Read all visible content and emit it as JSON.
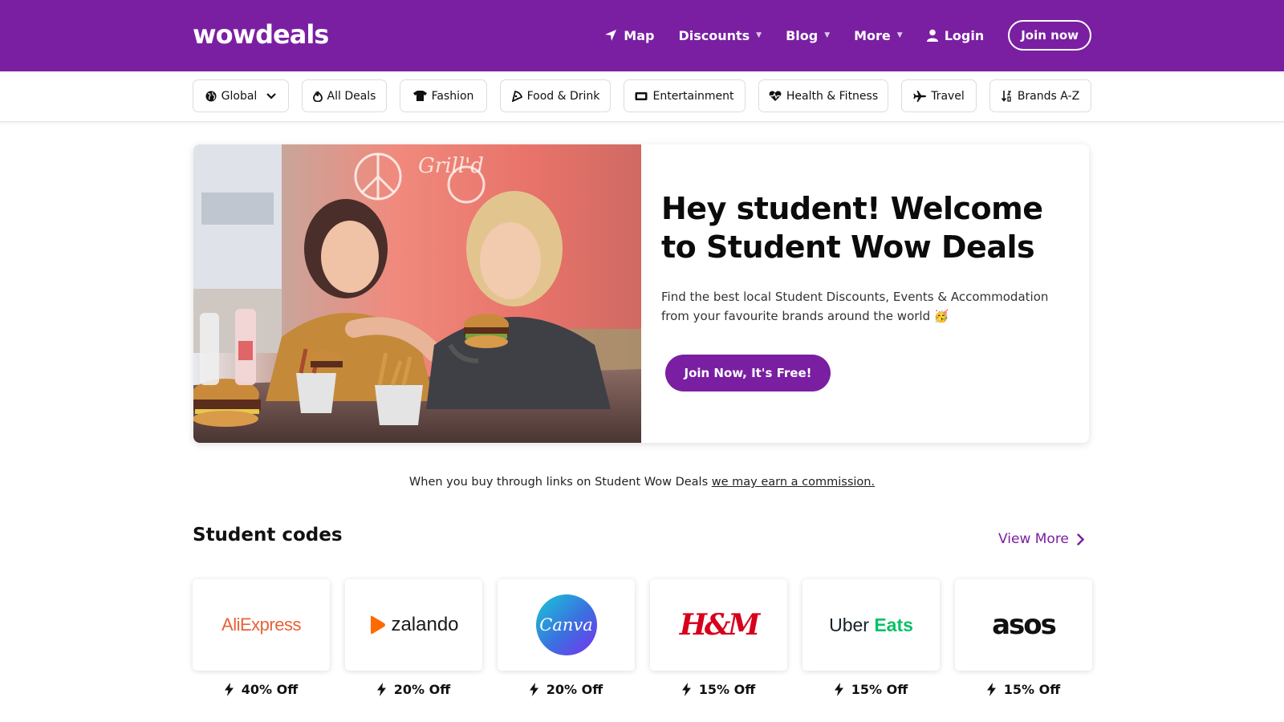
{
  "brand": {
    "logo": "wowdeals",
    "accent": "#7a1fa2"
  },
  "nav": {
    "map": "Map",
    "discounts": "Discounts",
    "blog": "Blog",
    "more": "More",
    "login": "Login",
    "join": "Join now"
  },
  "categories": [
    {
      "label": "Global",
      "icon": "globe-icon"
    },
    {
      "label": "All Deals",
      "icon": "fire-icon"
    },
    {
      "label": "Fashion",
      "icon": "shirt-icon"
    },
    {
      "label": "Food & Drink",
      "icon": "pizza-icon"
    },
    {
      "label": "Entertainment",
      "icon": "ticket-icon"
    },
    {
      "label": "Health & Fitness",
      "icon": "heartbeat-icon"
    },
    {
      "label": "Travel",
      "icon": "plane-icon"
    },
    {
      "label": "Brands A-Z",
      "icon": "sort-icon"
    }
  ],
  "hero": {
    "title": "Hey student! Welcome to Student Wow Deals",
    "text": "Find the best local Student Discounts, Events & Accommodation from your favourite brands around the world 🥳",
    "cta": "Join Now, It's Free!"
  },
  "disclaimer": {
    "text": "When you buy through links on Student Wow Deals ",
    "link": "we may earn a commission."
  },
  "student_codes": {
    "title": "Student codes",
    "view_more": "View More",
    "brands": [
      {
        "name": "AliExpress",
        "discount": "40% Off"
      },
      {
        "name": "zalando",
        "discount": "20% Off"
      },
      {
        "name": "Canva",
        "discount": "20% Off"
      },
      {
        "name": "H&M",
        "discount": "15% Off"
      },
      {
        "name": "Uber Eats",
        "discount": "15% Off"
      },
      {
        "name": "asos",
        "discount": "15% Off"
      }
    ]
  }
}
